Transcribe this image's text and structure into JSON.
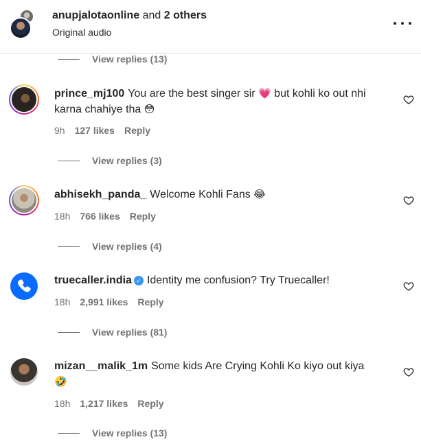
{
  "header": {
    "user": "anupjalotaonline",
    "joiner": "and",
    "others": "2 others",
    "subtitle": "Original audio"
  },
  "top_view_replies": "View replies (13)",
  "comments": [
    {
      "username": "prince_mj100",
      "text_part1": "You are the best singer sir",
      "emoji1": "💗",
      "text_part2": "but kohli ko out nhi karna chahiye tha",
      "emoji2": "😳",
      "time": "9h",
      "likes": "127 likes",
      "reply": "Reply",
      "view_replies": "View replies (3)"
    },
    {
      "username": "abhisekh_panda_",
      "text_part1": "Welcome Kohli Fans",
      "emoji1": "😂",
      "time": "18h",
      "likes": "766 likes",
      "reply": "Reply",
      "view_replies": "View replies (4)"
    },
    {
      "username": "truecaller.india",
      "verified": true,
      "text_part1": "Identity me confusion? Try Truecaller!",
      "time": "18h",
      "likes": "2,991 likes",
      "reply": "Reply",
      "view_replies": "View replies (81)"
    },
    {
      "username": "mizan__malik_1m",
      "text_part1": "Some kids Are Crying Kohli Ko kiyo out kiya",
      "emoji1": "🤣",
      "time": "18h",
      "likes": "1,217 likes",
      "reply": "Reply",
      "view_replies": "View replies (13)"
    }
  ],
  "icons": {
    "more": "more-options-icon",
    "like": "heart-outline-icon",
    "verified": "verified-badge-icon"
  },
  "colors": {
    "text_primary": "#262626",
    "text_secondary": "#737373",
    "verified_blue": "#3897f0",
    "truecaller_blue": "#0a6cff"
  }
}
